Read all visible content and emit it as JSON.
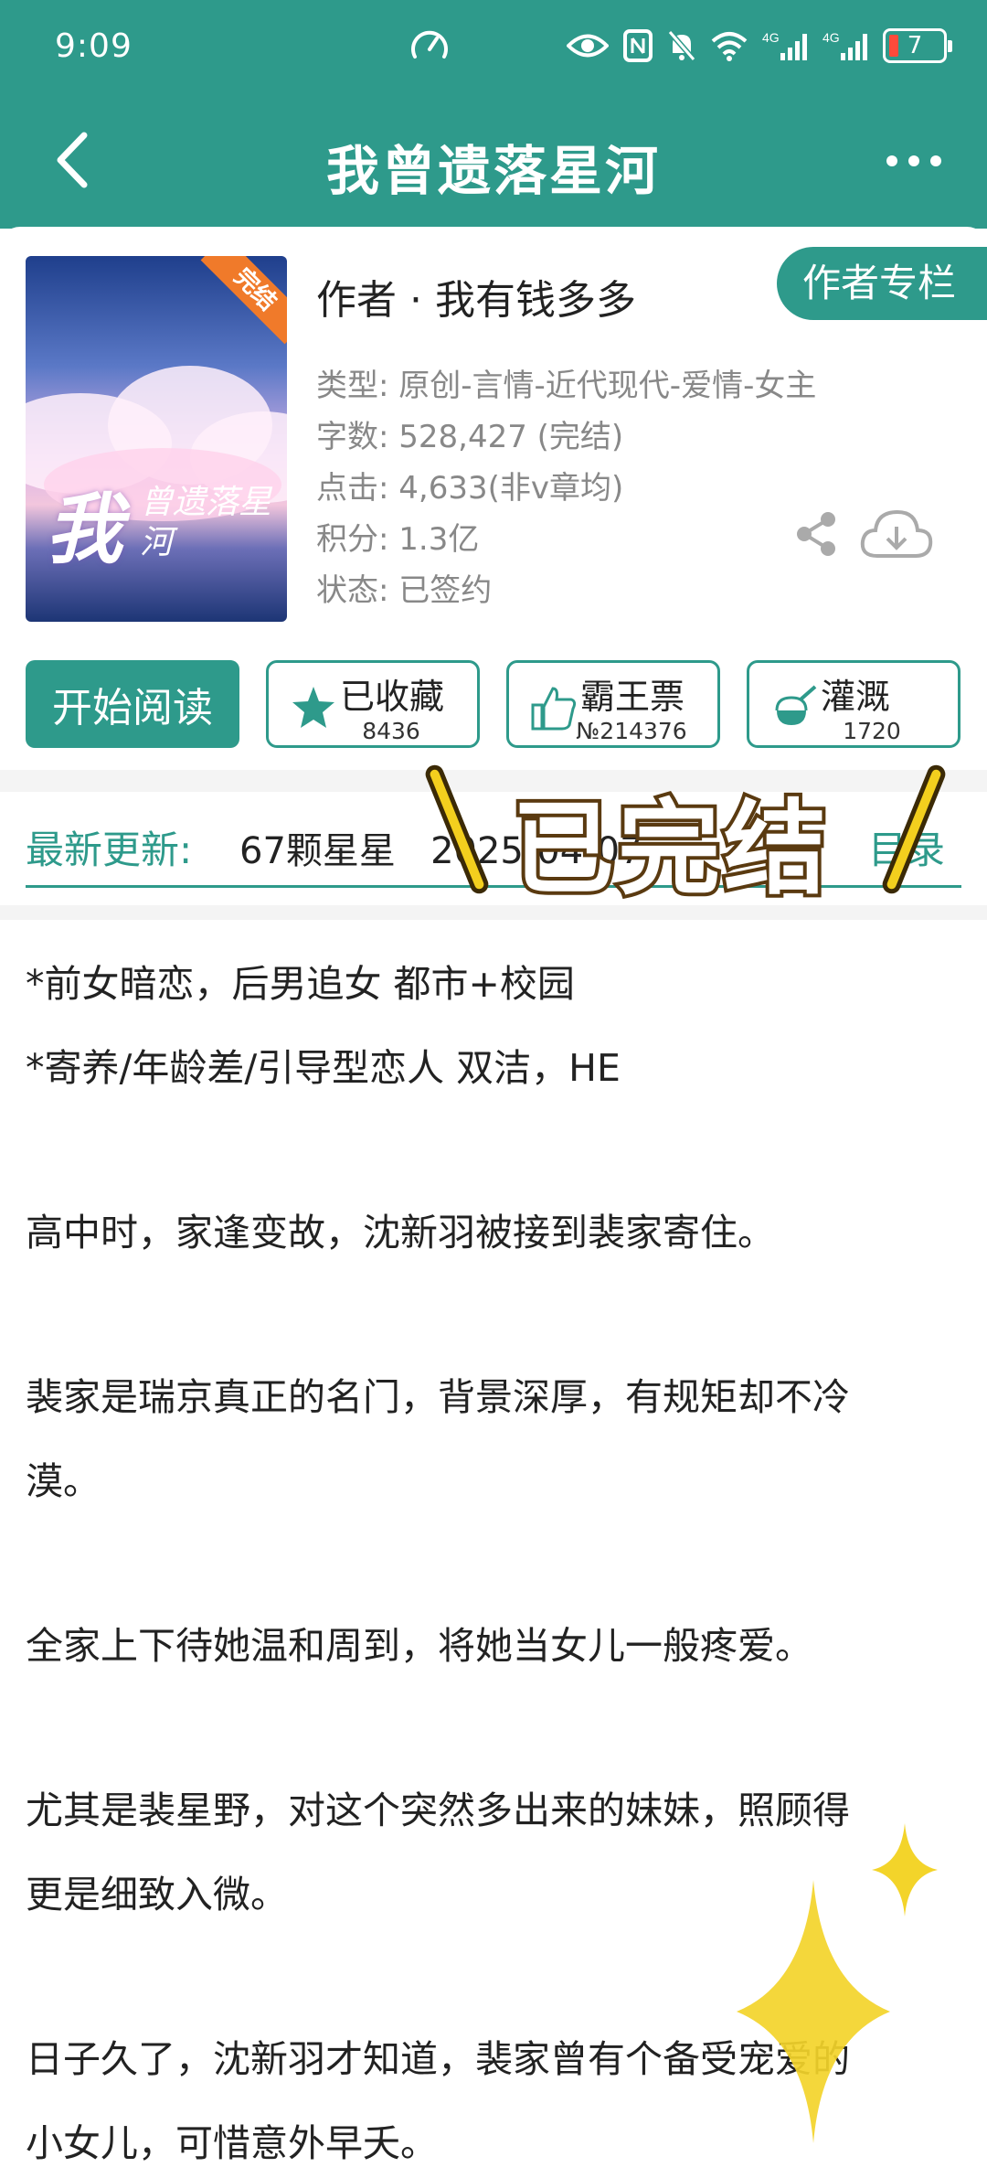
{
  "status_bar": {
    "time": "9:09",
    "network_1": "4G",
    "network_2": "4G",
    "battery": "7"
  },
  "nav": {
    "title": "我曾遗落星河"
  },
  "book": {
    "cover_stamp": "完结",
    "cover_title_big": "我",
    "cover_title_small": "曾遗落星河",
    "author": "作者 · 我有钱多多",
    "author_column_button": "作者专栏",
    "type": "类型: 原创-言情-近代现代-爱情-女主",
    "word_count": "字数: 528,427 (完结)",
    "clicks": "点击: 4,633(非v章均)",
    "score": "积分: 1.3亿",
    "status": "状态: 已签约"
  },
  "actions": {
    "read_label": "开始阅读",
    "collect_label": "已收藏",
    "collect_count": "8436",
    "vote_label": "霸王票",
    "vote_count": "№214376",
    "water_label": "灌溉",
    "water_count": "1720"
  },
  "latest": {
    "label": "最新更新:",
    "chapter": "67颗星星",
    "date": "2025-04-07",
    "toc": "目录"
  },
  "overlay": {
    "text": "已完结"
  },
  "description": [
    "*前女暗恋，后男追女   都市+校园",
    "*寄养/年龄差/引导型恋人  双洁，HE",
    "",
    "高中时，家逢变故，沈新羽被接到裴家寄住。",
    "",
    "裴家是瑞京真正的名门，背景深厚，有规矩却不冷",
    "漠。",
    "",
    "全家上下待她温和周到，将她当女儿一般疼爱。",
    "",
    "尤其是裴星野，对这个突然多出来的妹妹，照顾得",
    "更是细致入微。",
    "",
    "日子久了，沈新羽才知道，裴家曾有个备受宠爱的",
    "小女儿，可惜意外早夭。"
  ],
  "colors": {
    "brand": "#2e9a8b",
    "overlay_yellow": "#f3cf1e"
  }
}
